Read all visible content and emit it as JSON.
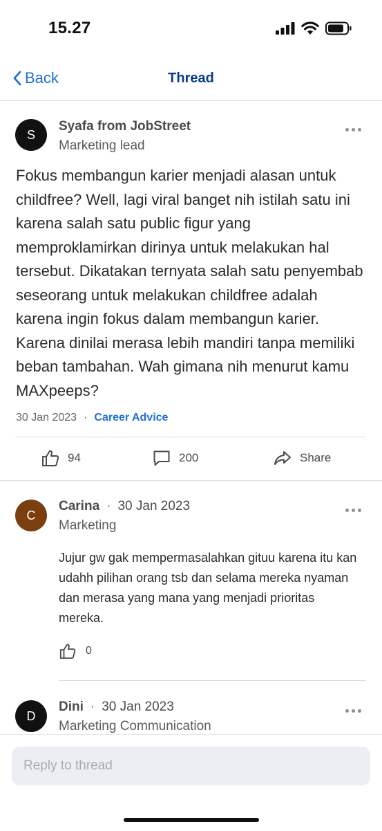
{
  "status_bar": {
    "time": "15.27"
  },
  "nav": {
    "back_label": "Back",
    "title": "Thread"
  },
  "post": {
    "avatar_letter": "S",
    "author": "Syafa from JobStreet",
    "role": "Marketing lead",
    "body": "Fokus membangun karier menjadi alasan untuk childfree? Well, lagi viral banget nih istilah satu ini karena salah satu public figur yang memproklamirkan dirinya untuk melakukan hal tersebut. Dikatakan ternyata salah satu penyembab seseorang untuk melakukan childfree adalah karena ingin fokus dalam membangun karier. Karena dinilai merasa lebih mandiri tanpa memiliki beban tambahan. Wah gimana nih menurut kamu MAXpeeps?",
    "date": "30 Jan 2023",
    "separator": "·",
    "category": "Career Advice",
    "likes": "94",
    "comments": "200",
    "share_label": "Share"
  },
  "comments": [
    {
      "avatar_letter": "C",
      "avatar_color": "#7a3e0f",
      "author": "Carina",
      "separator": "·",
      "date": "30 Jan 2023",
      "role": "Marketing",
      "body": "Jujur gw gak mempermasalahkan gituu karena itu kan udahh pilihan orang tsb dan selama mereka nyaman dan merasa yang mana yang menjadi prioritas mereka.",
      "likes": "0"
    },
    {
      "avatar_letter": "D",
      "avatar_color": "#111111",
      "author": "Dini",
      "separator": "·",
      "date": "30 Jan 2023",
      "role": "Marketing Communication"
    }
  ],
  "reply": {
    "placeholder": "Reply to thread"
  },
  "colors": {
    "link": "#1f6fd1",
    "title": "#0b3a88",
    "divider": "#dcdde0"
  }
}
